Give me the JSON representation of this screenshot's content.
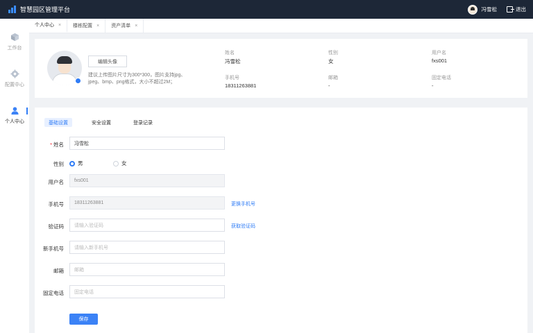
{
  "app": {
    "title": "智慧园区管理平台"
  },
  "topbar": {
    "user_name": "冯雪松",
    "logout_label": "退出"
  },
  "sidebar": {
    "items": [
      {
        "label": "工作台",
        "icon": "cube-icon"
      },
      {
        "label": "配置中心",
        "icon": "gear-icon"
      },
      {
        "label": "个人中心",
        "icon": "user-icon"
      }
    ]
  },
  "tabs": [
    {
      "label": "个人中心",
      "close": "×",
      "active": true
    },
    {
      "label": "楼栋配置",
      "close": "×",
      "active": false
    },
    {
      "label": "资产清单",
      "close": "×",
      "active": false
    }
  ],
  "profile": {
    "edit_avatar_label": "编辑头像",
    "hint": "建议上传图片尺寸为300*300，图片支持jpg、jpeg、bmp、png格式，大小不超过2M；",
    "fields": [
      {
        "label": "姓名",
        "value": "冯雪松"
      },
      {
        "label": "性别",
        "value": "女"
      },
      {
        "label": "用户名",
        "value": "fxs001"
      },
      {
        "label": "手机号",
        "value": "18311263881"
      },
      {
        "label": "邮箱",
        "value": "-"
      },
      {
        "label": "固定电话",
        "value": "-"
      }
    ]
  },
  "settings": {
    "subtabs": [
      "基础设置",
      "安全设置",
      "登录记录"
    ],
    "form": {
      "name_label": "姓名",
      "name_value": "冯雪松",
      "required_mark": "*",
      "gender_label": "性别",
      "gender_options": [
        "男",
        "女"
      ],
      "gender_selected": "男",
      "username_label": "用户名",
      "username_value": "fxs001",
      "phone_label": "手机号",
      "phone_value": "18311263881",
      "change_phone_link": "更换手机号",
      "code_label": "验证码",
      "code_placeholder": "请输入验证码",
      "get_code_link": "获取验证码",
      "new_phone_label": "新手机号",
      "new_phone_placeholder": "请输入新手机号",
      "email_label": "邮箱",
      "email_placeholder": "邮箱",
      "landline_label": "固定电话",
      "landline_placeholder": "固定电话",
      "save_label": "保存"
    }
  },
  "colors": {
    "accent": "#2f7cf6",
    "topbar": "#1d2737",
    "background": "#f0f2f5"
  }
}
